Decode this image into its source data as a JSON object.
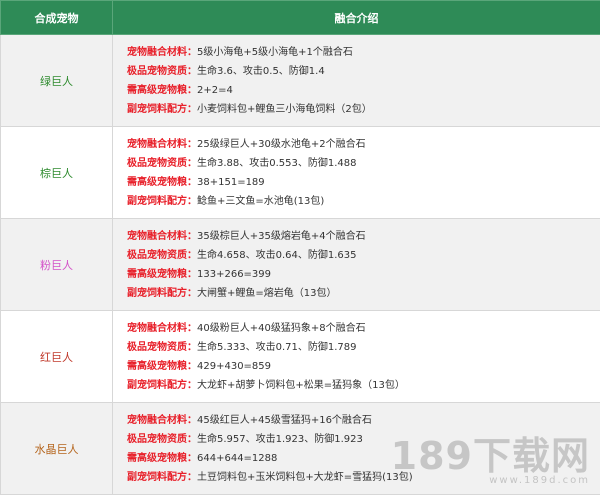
{
  "header": {
    "col1": "合成宠物",
    "col2": "融合介绍"
  },
  "labels": {
    "materials": "宠物融合材料：",
    "stats": "极品宠物资质：",
    "food": "需高级宠物粮：",
    "recipe": "副宠饲料配方："
  },
  "pets": [
    {
      "name": "绿巨人",
      "color": "#2e8b2e",
      "materials": "5级小海龟+5级小海龟+1个融合石",
      "stats": "生命3.6、攻击0.5、防御1.4",
      "food": "2+2=4",
      "recipe": "小麦饲料包+鲤鱼三小海龟饲料（2包）"
    },
    {
      "name": "棕巨人",
      "color": "#2e8b2e",
      "materials": "25级绿巨人+30级水池龟+2个融合石",
      "stats": "生命3.88、攻击0.553、防御1.488",
      "food": "38+151=189",
      "recipe": "鲶鱼+三文鱼=水池龟(13包)"
    },
    {
      "name": "粉巨人",
      "color": "#d452c8",
      "materials": "35级棕巨人+35级熔岩龟+4个融合石",
      "stats": "生命4.658、攻击0.64、防御1.635",
      "food": "133+266=399",
      "recipe": "大闸蟹+鲤鱼=熔岩龟（13包）"
    },
    {
      "name": "红巨人",
      "color": "#c0392b",
      "materials": "40级粉巨人+40级猛犸象+8个融合石",
      "stats": "生命5.333、攻击0.71、防御1.789",
      "food": "429+430=859",
      "recipe": "大龙虾+胡萝卜饲料包+松果=猛犸象（13包）"
    },
    {
      "name": "水晶巨人",
      "color": "#b5651d",
      "materials": "45级红巨人+45级雪猛犸+16个融合石",
      "stats": "生命5.957、攻击1.923、防御1.923",
      "food": "644+644=1288",
      "recipe": "土豆饲料包+玉米饲料包+大龙虾=雪猛犸(13包)"
    }
  ],
  "watermark": {
    "main": "189下载网",
    "sub": "www.189d.com"
  }
}
